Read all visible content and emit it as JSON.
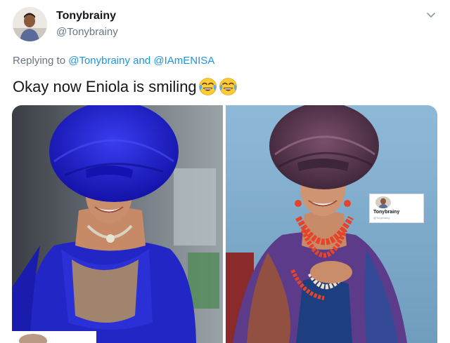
{
  "tweet": {
    "author_name": "Tonybrainy",
    "author_handle": "@Tonybrainy",
    "replying_prefix": "Replying to",
    "replying_user_1": "@Tonybrainy",
    "replying_and": "and",
    "replying_user_2": "@IAmENISA",
    "text": "Okay now Eniola is smiling",
    "emojis": [
      "face-with-tears-of-joy-icon",
      "face-with-tears-of-joy-icon"
    ]
  },
  "media": {
    "photo_count": 2,
    "inset_card": {
      "name": "Tonybrainy",
      "handle": "@Tonybrainy"
    }
  },
  "colors": {
    "link": "#1b95e0",
    "secondary_text": "#657786",
    "gele_left": "#1e21c8",
    "gele_right": "#5a3a55",
    "background_right": "#89b5d4"
  }
}
